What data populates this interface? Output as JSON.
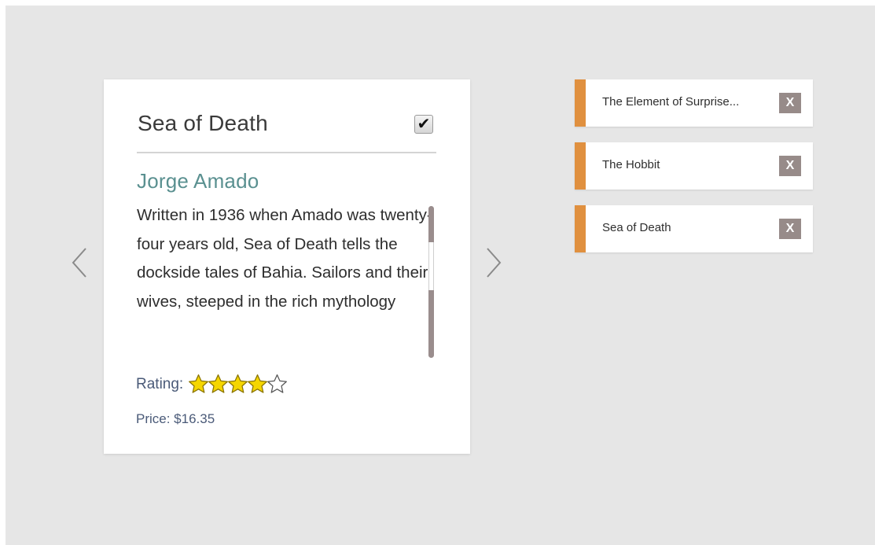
{
  "book": {
    "title": "Sea of Death",
    "checkbox_mark": "✔",
    "author": "Jorge Amado",
    "description": "Written in 1936 when Amado was twenty-four years old, Sea of Death tells the dockside tales of Bahia. Sailors and their wives, steeped in the rich mythology",
    "rating_label": "Rating:",
    "rating": 4,
    "rating_max": 5,
    "price": "Price: $16.35"
  },
  "navigation": {
    "prev_icon": "chevron-left-icon",
    "next_icon": "chevron-right-icon"
  },
  "reading_list": [
    {
      "title": "The Element of Surprise...",
      "remove_label": "X"
    },
    {
      "title": "The Hobbit",
      "remove_label": "X"
    },
    {
      "title": "Sea of Death",
      "remove_label": "X"
    }
  ],
  "colors": {
    "background": "#e6e6e6",
    "accent_stripe": "#e0903f",
    "author": "#5a9090",
    "meta_text": "#4a5a78",
    "close_button": "#978b89",
    "star_fill": "#f5d600"
  }
}
